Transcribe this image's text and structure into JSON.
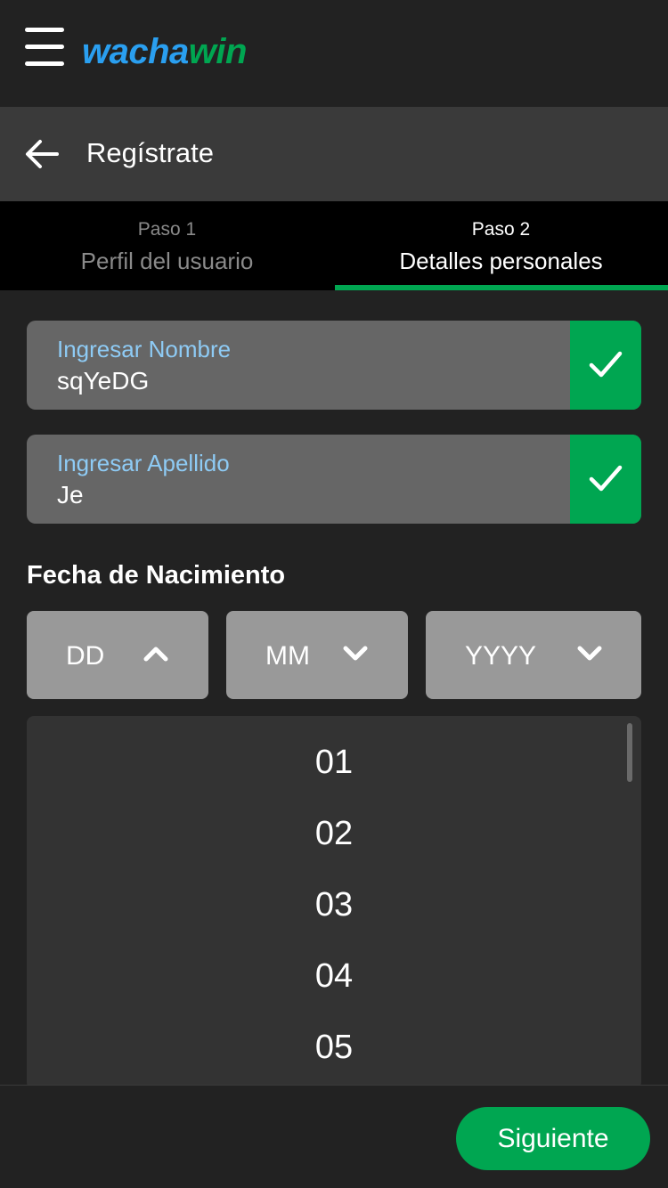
{
  "app": {
    "logo_part1": "wacha",
    "logo_part2": "win",
    "brand_blue": "#2a9ff0",
    "brand_green": "#00a651"
  },
  "header": {
    "title": "Regístrate",
    "back_icon": "arrow-left-icon",
    "menu_icon": "hamburger-menu-icon"
  },
  "steps": [
    {
      "number": "Paso 1",
      "name": "Perfil del usuario",
      "active": false
    },
    {
      "number": "Paso 2",
      "name": "Detalles personales",
      "active": true
    }
  ],
  "form": {
    "first_name": {
      "label": "Ingresar Nombre",
      "value": "sqYeDG",
      "valid": true
    },
    "last_name": {
      "label": "Ingresar Apellido",
      "value": "Je",
      "valid": true
    },
    "dob": {
      "label": "Fecha de Nacimiento",
      "day": {
        "placeholder": "DD",
        "open": true
      },
      "month": {
        "placeholder": "MM",
        "open": false
      },
      "year": {
        "placeholder": "YYYY",
        "open": false
      },
      "day_options": [
        "01",
        "02",
        "03",
        "04",
        "05"
      ]
    }
  },
  "footer": {
    "next_label": "Siguiente"
  }
}
